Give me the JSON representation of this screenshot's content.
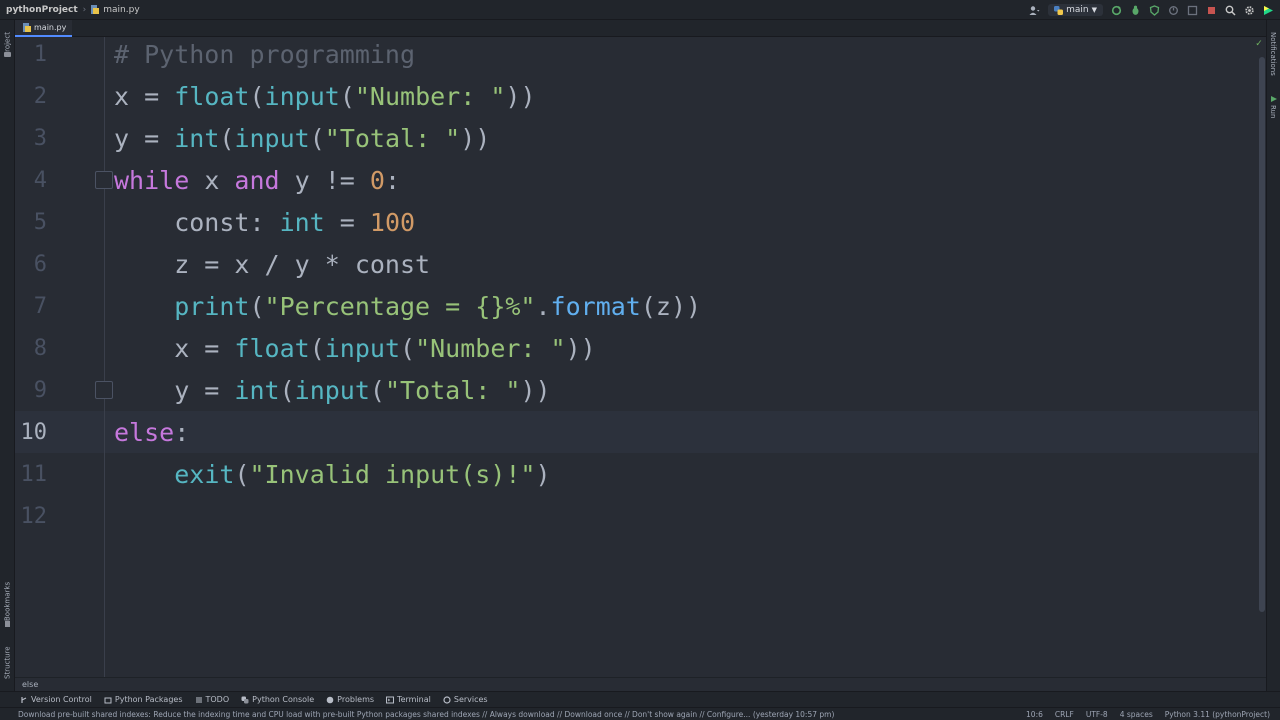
{
  "navbar": {
    "project": "pythonProject",
    "file": "main.py",
    "branch": "main"
  },
  "left_stripe": {
    "project_label": "Project",
    "bookmarks_label": "Bookmarks",
    "structure_label": "Structure"
  },
  "right_stripe": {
    "notifications_label": "Notifications",
    "run_label": "Run"
  },
  "tabs": [
    {
      "label": "main.py",
      "active": true
    }
  ],
  "editor": {
    "line_numbers": [
      "1",
      "2",
      "3",
      "4",
      "5",
      "6",
      "7",
      "8",
      "9",
      "10",
      "11",
      "12"
    ],
    "current_line": "10",
    "lines": [
      [
        {
          "t": "# Python programming",
          "c": "com"
        }
      ],
      [
        {
          "t": "x = ",
          "c": "id"
        },
        {
          "t": "float",
          "c": "fn"
        },
        {
          "t": "(",
          "c": "id"
        },
        {
          "t": "input",
          "c": "fn"
        },
        {
          "t": "(",
          "c": "id"
        },
        {
          "t": "\"Number: \"",
          "c": "str"
        },
        {
          "t": "))",
          "c": "id"
        }
      ],
      [
        {
          "t": "y = ",
          "c": "id"
        },
        {
          "t": "int",
          "c": "fn"
        },
        {
          "t": "(",
          "c": "id"
        },
        {
          "t": "input",
          "c": "fn"
        },
        {
          "t": "(",
          "c": "id"
        },
        {
          "t": "\"Total: \"",
          "c": "str"
        },
        {
          "t": "))",
          "c": "id"
        }
      ],
      [
        {
          "t": "while",
          "c": "kw"
        },
        {
          "t": " x ",
          "c": "id"
        },
        {
          "t": "and",
          "c": "kw"
        },
        {
          "t": " y != ",
          "c": "id"
        },
        {
          "t": "0",
          "c": "num"
        },
        {
          "t": ":",
          "c": "id"
        }
      ],
      [
        {
          "t": "    const: ",
          "c": "id"
        },
        {
          "t": "int",
          "c": "fn"
        },
        {
          "t": " = ",
          "c": "id"
        },
        {
          "t": "100",
          "c": "num"
        }
      ],
      [
        {
          "t": "    z = x / y * const",
          "c": "id"
        }
      ],
      [
        {
          "t": "    ",
          "c": "id"
        },
        {
          "t": "print",
          "c": "fn"
        },
        {
          "t": "(",
          "c": "id"
        },
        {
          "t": "\"Percentage = {}%\"",
          "c": "str"
        },
        {
          "t": ".",
          "c": "id"
        },
        {
          "t": "format",
          "c": "met"
        },
        {
          "t": "(z))",
          "c": "id"
        }
      ],
      [
        {
          "t": "    x = ",
          "c": "id"
        },
        {
          "t": "float",
          "c": "fn"
        },
        {
          "t": "(",
          "c": "id"
        },
        {
          "t": "input",
          "c": "fn"
        },
        {
          "t": "(",
          "c": "id"
        },
        {
          "t": "\"Number: \"",
          "c": "str"
        },
        {
          "t": "))",
          "c": "id"
        }
      ],
      [
        {
          "t": "    y = ",
          "c": "id"
        },
        {
          "t": "int",
          "c": "fn"
        },
        {
          "t": "(",
          "c": "id"
        },
        {
          "t": "input",
          "c": "fn"
        },
        {
          "t": "(",
          "c": "id"
        },
        {
          "t": "\"Total: \"",
          "c": "str"
        },
        {
          "t": "))",
          "c": "id"
        }
      ],
      [
        {
          "t": "else",
          "c": "kw"
        },
        {
          "t": ":",
          "c": "id"
        }
      ],
      [
        {
          "t": "    ",
          "c": "id"
        },
        {
          "t": "exit",
          "c": "fn"
        },
        {
          "t": "(",
          "c": "id"
        },
        {
          "t": "\"Invalid input(s)!\"",
          "c": "str"
        },
        {
          "t": ")",
          "c": "id"
        }
      ],
      []
    ]
  },
  "breadcrumb": "else",
  "tool_windows": [
    {
      "label": "Version Control",
      "icon": "branch-icon"
    },
    {
      "label": "Python Packages",
      "icon": "package-icon"
    },
    {
      "label": "TODO",
      "icon": "list-icon"
    },
    {
      "label": "Python Console",
      "icon": "python-icon"
    },
    {
      "label": "Problems",
      "icon": "warning-icon"
    },
    {
      "label": "Terminal",
      "icon": "terminal-icon"
    },
    {
      "label": "Services",
      "icon": "services-icon"
    }
  ],
  "status": {
    "message": "Download pre-built shared indexes: Reduce the indexing time and CPU load with pre-built Python packages shared indexes // Always download // Download once // Don't show again // Configure... (yesterday 10:57 pm)",
    "position": "10:6",
    "line_sep": "CRLF",
    "encoding": "UTF-8",
    "indent": "4 spaces",
    "interpreter": "Python 3.11 (pythonProject)"
  },
  "colors": {
    "keyword": "#c678dd",
    "builtin": "#56b6c2",
    "string": "#98c379",
    "number": "#d19a66",
    "method": "#61afef",
    "comment": "#5c6370",
    "accent": "#528bff"
  }
}
